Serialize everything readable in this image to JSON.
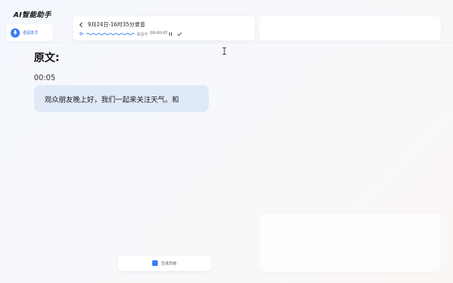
{
  "app": {
    "title": "AI智能助手"
  },
  "sidebar": {
    "assistant_label": "语音助手"
  },
  "recording": {
    "title": "9月24日-16时35分录音",
    "status": "录音中",
    "elapsed": "00:00:07"
  },
  "transcript": {
    "heading": "原文:",
    "segments": [
      {
        "time": "00:05",
        "text": "观众朋友晚上好，我们一起来关注天气。和"
      }
    ]
  },
  "actions": {
    "summary_label": "生成总结"
  },
  "colors": {
    "accent": "#3b7cf6",
    "bubble": "#dfe9f7"
  },
  "icons": [
    "microphone-icon",
    "back-chevron-icon",
    "sound-wave-icon",
    "pause-icon",
    "check-icon",
    "cursor-icon",
    "document-icon"
  ]
}
